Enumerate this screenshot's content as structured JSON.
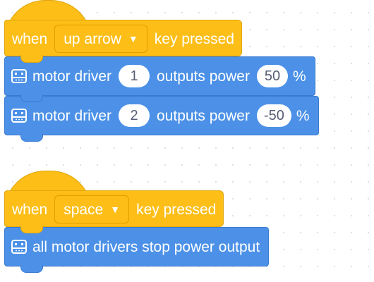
{
  "stack1": {
    "hat": {
      "when": "when",
      "key": "up arrow",
      "caret": "▼",
      "suffix": "key pressed"
    },
    "commands": [
      {
        "icon": "motor-driver-icon",
        "label": "motor driver",
        "driver": "1",
        "mid": "outputs power",
        "power": "50",
        "unit": "%"
      },
      {
        "icon": "motor-driver-icon",
        "label": "motor driver",
        "driver": "2",
        "mid": "outputs power",
        "power": "-50",
        "unit": "%"
      }
    ]
  },
  "stack2": {
    "hat": {
      "when": "when",
      "key": "space",
      "caret": "▼",
      "suffix": "key pressed"
    },
    "commands": [
      {
        "icon": "motor-driver-icon",
        "label": "all motor drivers stop power output"
      }
    ]
  },
  "colors": {
    "event": "#fcbe17",
    "command": "#4c91e7",
    "oval_text": "#575e75"
  }
}
